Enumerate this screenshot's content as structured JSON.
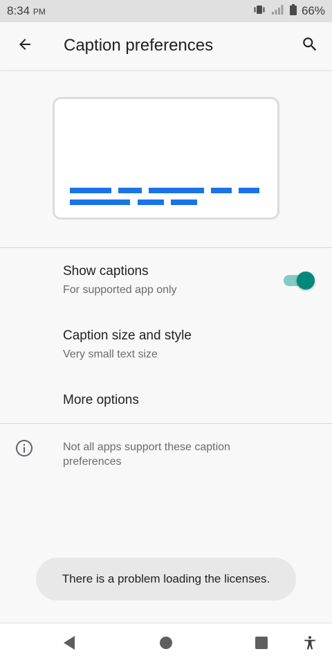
{
  "status_bar": {
    "time": "8:34",
    "ampm": "PM",
    "battery": "66%",
    "icons": [
      "vibrate-icon",
      "signal-icon",
      "battery-icon"
    ]
  },
  "app_bar": {
    "title": "Caption preferences",
    "back_icon": "arrow-back-icon",
    "search_icon": "search-icon"
  },
  "preview": {
    "accent": "#1a73e8"
  },
  "settings": {
    "show_captions": {
      "title": "Show captions",
      "summary": "For supported app only",
      "enabled": true
    },
    "caption_size": {
      "title": "Caption size and style",
      "summary": "Very small text size"
    },
    "more_options": {
      "title": "More options"
    }
  },
  "info": {
    "icon": "info-icon",
    "text": "Not all apps support these caption preferences"
  },
  "toast": {
    "text": "There is a problem loading the licenses."
  },
  "nav_bar": {
    "icons": [
      "back-triangle-icon",
      "home-circle-icon",
      "recents-square-icon",
      "accessibility-icon"
    ]
  },
  "colors": {
    "toggle_thumb": "#00897b",
    "toggle_track": "#80cbc4",
    "caption_bar": "#1a73e8"
  }
}
